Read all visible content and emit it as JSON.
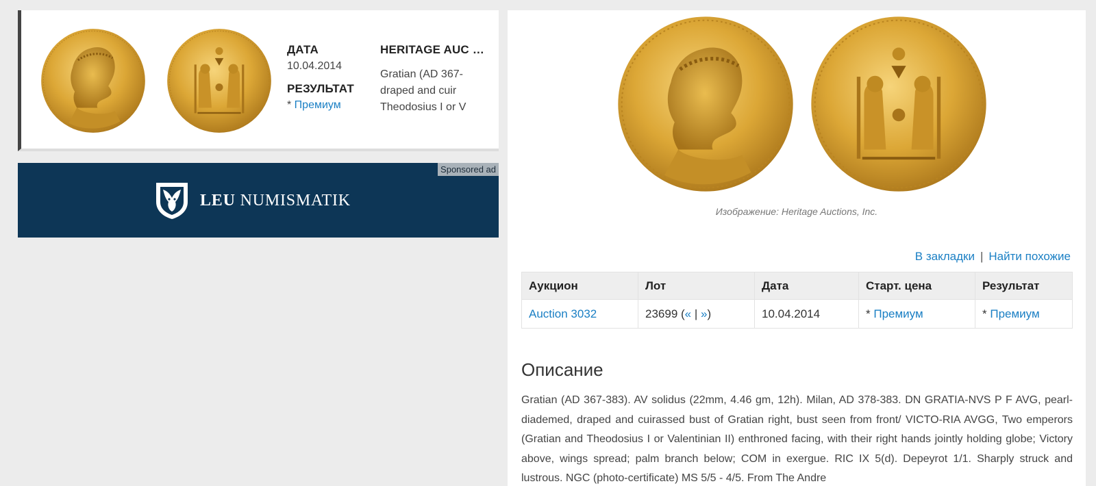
{
  "lot_card": {
    "date_label": "ДАТА",
    "date_value": "10.04.2014",
    "result_label": "РЕЗУЛЬТАТ",
    "result_prefix": "* ",
    "result_link": "Премиум",
    "auction_house": "HERITAGE AUC",
    "snippet": [
      "Gratian (AD 367-",
      "draped and cuir",
      "Theodosius I or V"
    ],
    "coin_legend_obverse": "DN GRATIA NVS P F AVG",
    "coin_legend_reverse": "VICTO RIA AVGG",
    "coin_exergue": "COM"
  },
  "ad": {
    "tag": "Sponsored ad",
    "brand_bold": "LEU",
    "brand_rest": "NUMISMATIK",
    "icon": "lion-shield-icon"
  },
  "image_caption": "Изображение: Heritage Auctions, Inc.",
  "actions": {
    "bookmark": "В закладки",
    "separator": "|",
    "similar": "Найти похожие"
  },
  "auction_table": {
    "headers": [
      "Аукцион",
      "Лот",
      "Дата",
      "Старт. цена",
      "Результат"
    ],
    "row": {
      "auction": "Auction 3032",
      "lot_number": "23699",
      "lot_open": " (",
      "prev": "«",
      "pipe": " | ",
      "next": "»",
      "lot_close": ")",
      "date": "10.04.2014",
      "start_prefix": "* ",
      "start_link": "Премиум",
      "result_prefix": "* ",
      "result_link": "Премиум"
    }
  },
  "description": {
    "title": "Описание",
    "text": "Gratian (AD 367-383). AV solidus (22mm, 4.46 gm, 12h).  Milan, AD 378-383. DN GRATIA-NVS P F AVG, pearl-diademed, draped and cuirassed bust of Gratian right, bust seen from front/ VICTO-RIA AVGG, Two emperors (Gratian and Theodosius I or Valentinian II) enthroned facing, with their right hands jointly holding globe; Victory above, wings spread; palm branch below; COM in exergue. RIC IX 5(d). Depeyrot 1/1. Sharply struck and lustrous. NGC (photo-certificate) MS 5/5 - 4/5. From The Andre"
  },
  "colors": {
    "link": "#1a7fc4",
    "ad_bg": "#0d3656",
    "gold": "#d9a531"
  }
}
